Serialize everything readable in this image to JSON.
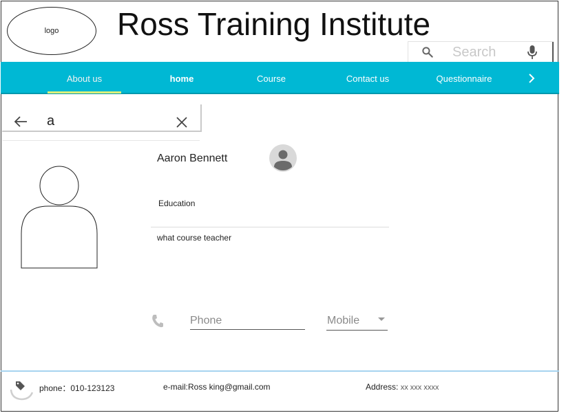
{
  "header": {
    "logo_text": "logo",
    "title": "Ross Training Institute",
    "search_placeholder": "Search"
  },
  "nav": {
    "items": [
      {
        "label": "About us",
        "active": true
      },
      {
        "label": "home"
      },
      {
        "label": "Course"
      },
      {
        "label": "Contact us"
      },
      {
        "label": "Questionnaire"
      }
    ],
    "next_icon": "chevron-right-icon"
  },
  "filter": {
    "value": "a",
    "back_icon": "arrow-left-icon",
    "clear_icon": "close-icon"
  },
  "profile": {
    "name": "Aaron Bennett",
    "education_label": "Education",
    "course_text": "what course teacher"
  },
  "contact": {
    "phone_placeholder": "Phone",
    "phone_type": "Mobile"
  },
  "footer": {
    "phone": "phone：010-123123",
    "email": "e-mail:Ross  king@gmail.com",
    "address_label": "Address: ",
    "address_value": "xx xxx xxxx"
  },
  "colors": {
    "nav_bg": "#00b8d4",
    "active_underline": "#ddf07a",
    "footer_line": "#a6d3ef"
  }
}
